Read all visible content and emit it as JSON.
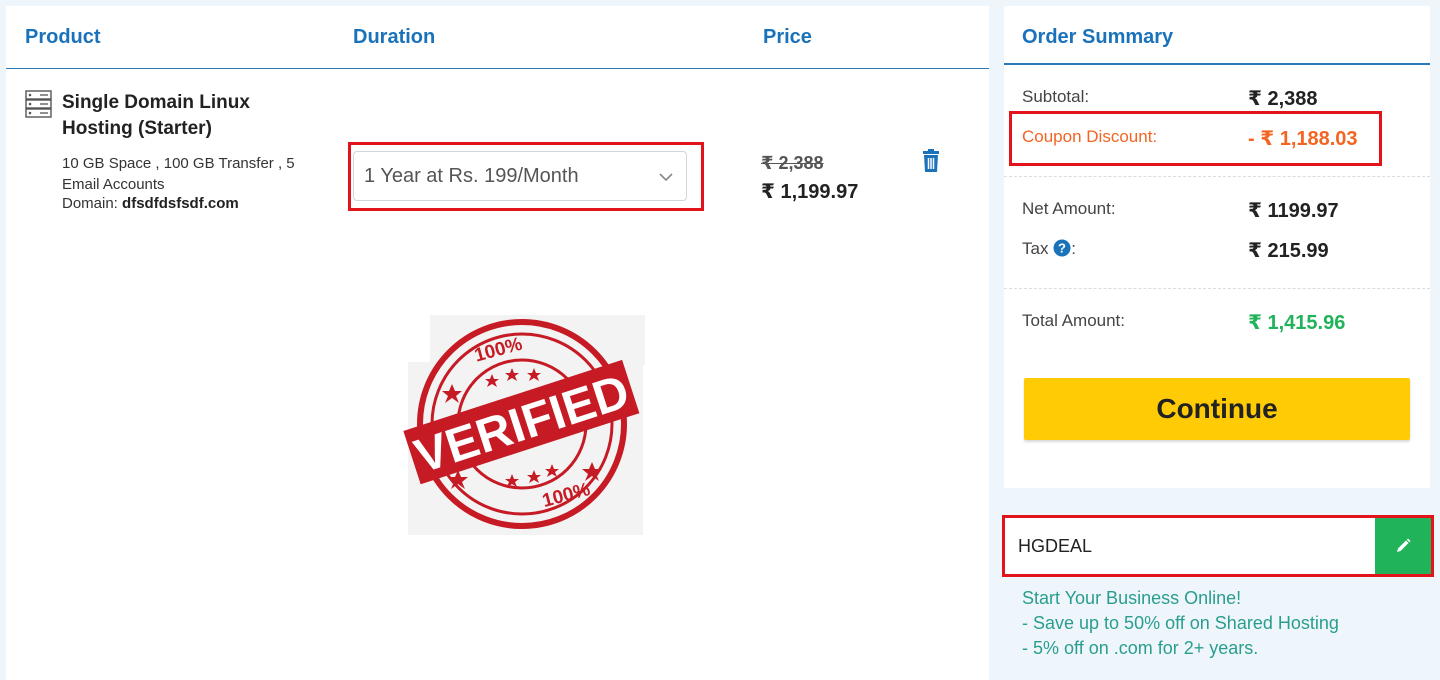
{
  "cart": {
    "headers": {
      "product": "Product",
      "duration": "Duration",
      "price": "Price"
    },
    "item": {
      "icon": "server-icon",
      "name": "Single Domain Linux Hosting (Starter)",
      "specs": "10 GB Space , 100 GB Transfer , 5 Email Accounts",
      "domain_label": "Domain:",
      "domain_value": "dfsdfdsfsdf.com",
      "duration": "1 Year at Rs. 199/Month",
      "price_old": "₹ 2,388",
      "price_new": "₹ 1,199.97"
    },
    "stamp": {
      "top_text": "100%",
      "word": "VERIFIED",
      "bottom_text": "100%"
    }
  },
  "summary": {
    "title": "Order Summary",
    "subtotal_label": "Subtotal:",
    "subtotal_value": "₹ 2,388",
    "discount_label": "Coupon Discount:",
    "discount_value": "- ₹ 1,188.03",
    "net_label": "Net Amount:",
    "net_value": "₹ 1199.97",
    "tax_label": "Tax",
    "tax_colon": ":",
    "tax_value": "₹ 215.99",
    "total_label": "Total Amount:",
    "total_value": "₹ 1,415.96",
    "continue_label": "Continue"
  },
  "coupon": {
    "code": "HGDEAL",
    "promo_lines": [
      "Start Your Business Online!",
      "- Save up to 50% off on Shared Hosting",
      "- 5% off on .com for 2+ years."
    ]
  },
  "colors": {
    "accent": "#1a72bb",
    "highlight": "#e3131c",
    "discount": "#f26522",
    "total": "#20b35a",
    "button": "#ffcb05"
  }
}
